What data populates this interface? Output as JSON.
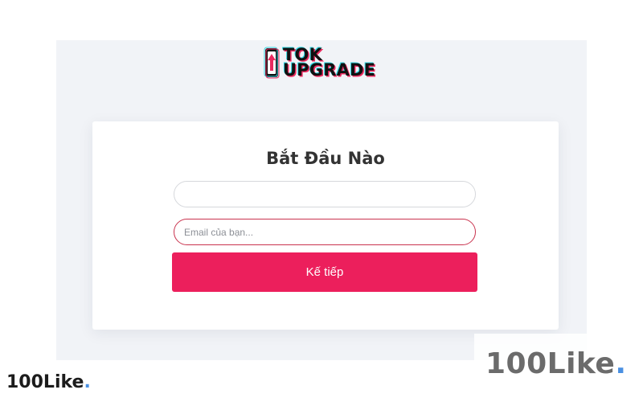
{
  "logo": {
    "line1": "TOK",
    "line2": "UPGRADE",
    "icon": "tok-upgrade-logo-icon"
  },
  "card": {
    "title": "Bắt Đầu Nào",
    "input1_value": "",
    "email_placeholder": "Email của bạn...",
    "submit_label": "Kế tiếp"
  },
  "watermark": {
    "text": "100Like",
    "dot": "."
  },
  "colors": {
    "accent": "#ec1f5c",
    "panel_bg": "#f1f3f7",
    "watermark_dot": "#4a90e2"
  }
}
